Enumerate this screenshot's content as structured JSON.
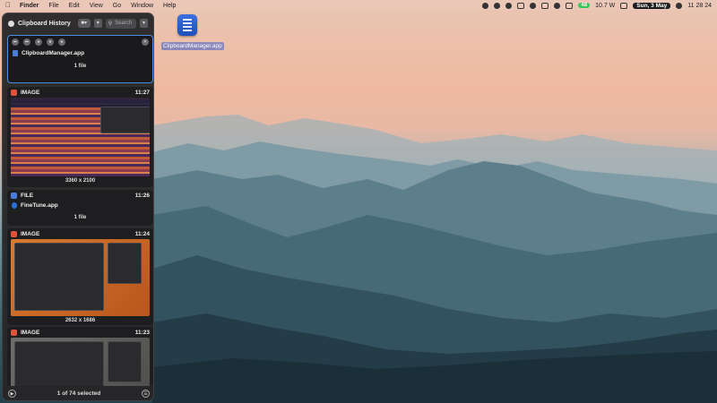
{
  "menubar": {
    "app_name": "Finder",
    "items": [
      "File",
      "Edit",
      "View",
      "Go",
      "Window",
      "Help"
    ],
    "battery": "48",
    "power": "10.7 W",
    "date": "Sun, 3 May",
    "time": "11 28 24"
  },
  "desktop_icon": {
    "label": "ClipboardManager.app",
    "icon": "document-icon"
  },
  "panel": {
    "title": "Clipboard History",
    "search_placeholder": "Search",
    "cards": [
      {
        "file_name": "ClipboardManager.app",
        "footer": "1 file"
      },
      {
        "type": "IMAGE",
        "time": "11:27",
        "footer": "3360 x 2100"
      },
      {
        "type": "FILE",
        "time": "11:26",
        "file_name": "FineTune.app",
        "footer": "1 file"
      },
      {
        "type": "IMAGE",
        "time": "11:24",
        "footer": "2632 x 1686"
      },
      {
        "type": "IMAGE",
        "time": "11:23"
      }
    ],
    "footer": "1 of 74 selected"
  },
  "colors": {
    "accent": "#4a90e2",
    "image_tag": "#e0533b",
    "file_tag": "#4a7bd8"
  }
}
